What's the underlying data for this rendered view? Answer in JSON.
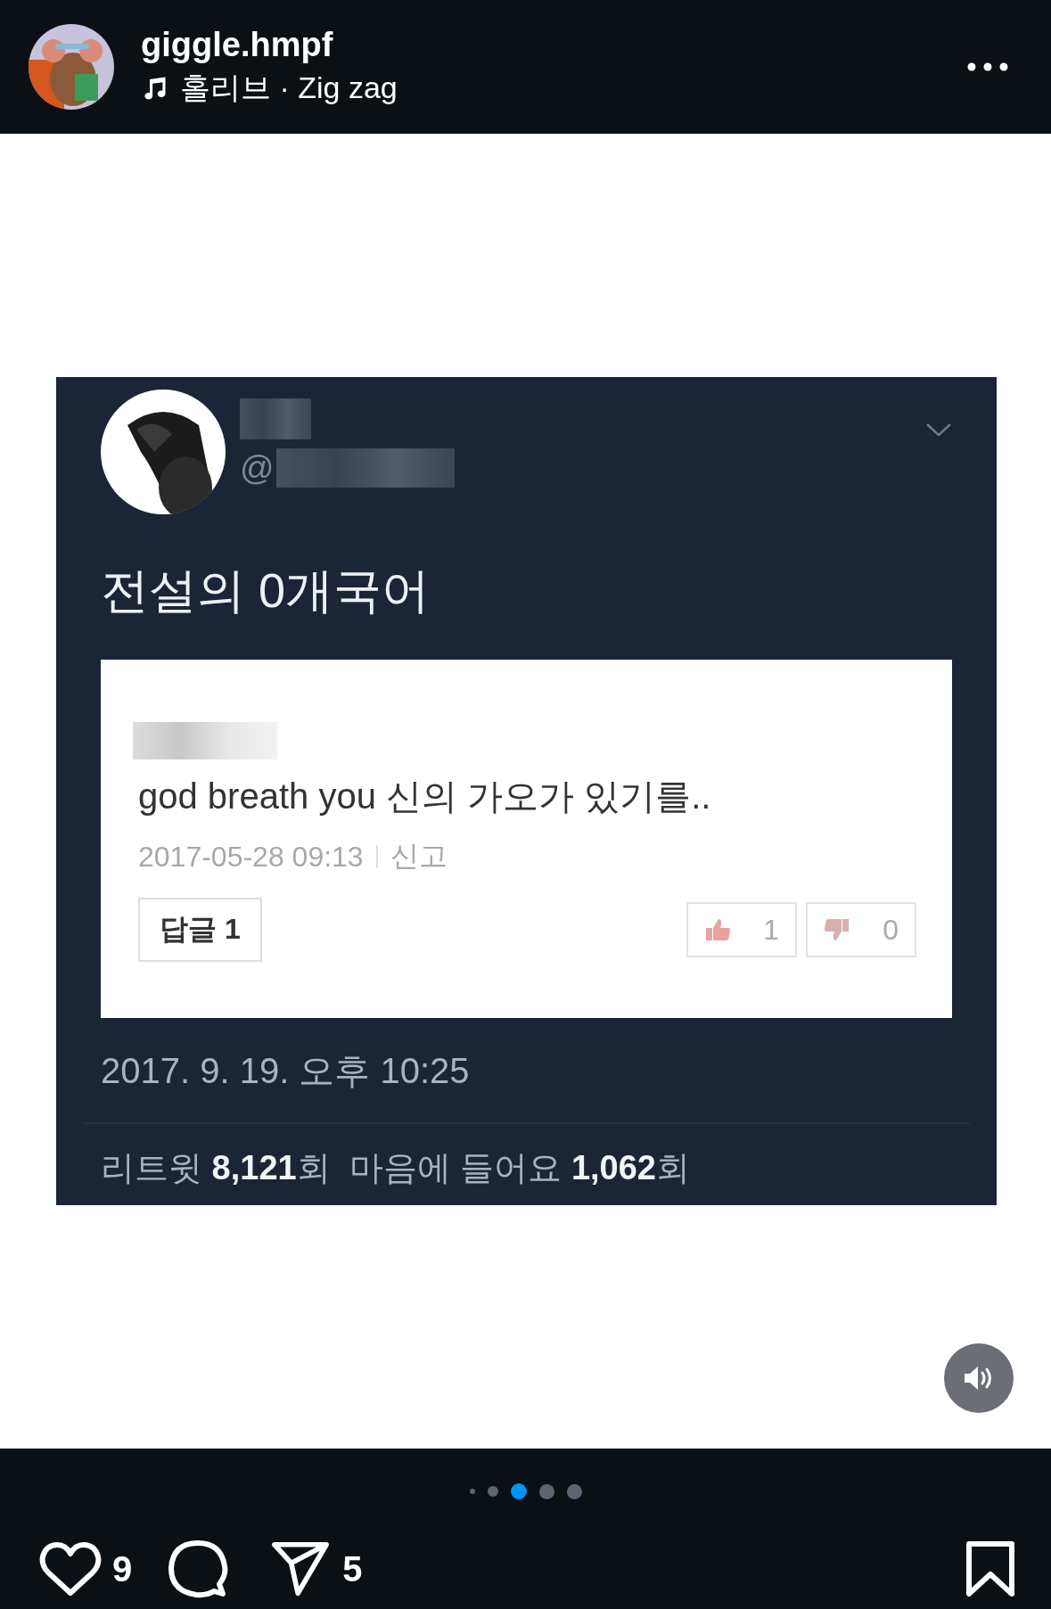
{
  "header": {
    "username": "giggle.hmpf",
    "music": "홀리브 · Zig zag"
  },
  "tweet": {
    "handle": "@",
    "text": "전설의 0개국어",
    "comment": {
      "text": "god breath you 신의 가오가 있기를..",
      "date": "2017-05-28 09:13",
      "report": "신고",
      "reply_button": "답글 1",
      "upvotes": "1",
      "downvotes": "0"
    },
    "timestamp": "2017. 9. 19. 오후 10:25",
    "stats": "리트윗 **8,121**회  마음에 들어요 **1,062**회"
  },
  "dots": [
    {
      "selected": false
    },
    {
      "selected": false
    },
    {
      "selected": true
    },
    {
      "selected": false
    },
    {
      "selected": false
    }
  ],
  "actions": {
    "likes": "9",
    "shares": "5"
  }
}
